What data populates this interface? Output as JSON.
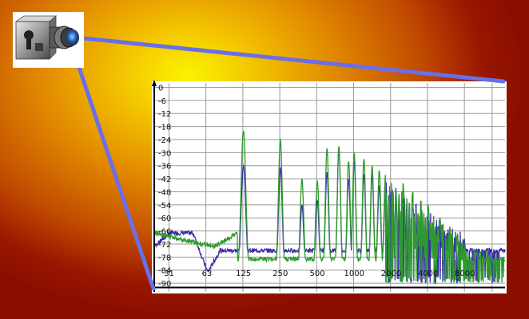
{
  "colors": {
    "beam": "#6a6ee8",
    "series_green": "#2e9a2e",
    "series_blue": "#3a2fa8",
    "axis": "#000000"
  },
  "camera": {
    "icon": "camera-icon"
  },
  "chart_data": {
    "type": "line",
    "y_ticks": [
      "0",
      "-6",
      "-12",
      "-18",
      "-24",
      "-30",
      "-36",
      "-42",
      "-48",
      "-54",
      "-60",
      "-66",
      "-72",
      "-78",
      "-84",
      "-90"
    ],
    "x_ticks": [
      "31",
      "63",
      "125",
      "250",
      "500",
      "1000",
      "2000",
      "4000",
      "8000"
    ],
    "ylim": [
      -94,
      2
    ],
    "xlim_log2": [
      4.55,
      14.05
    ],
    "grid": true,
    "series": [
      {
        "color": "green",
        "peaks": [
          {
            "x": 125,
            "y": -20
          },
          {
            "x": 250,
            "y": -24
          },
          {
            "x": 375,
            "y": -42
          },
          {
            "x": 500,
            "y": -43
          },
          {
            "x": 600,
            "y": -28
          },
          {
            "x": 750,
            "y": -27
          },
          {
            "x": 900,
            "y": -34
          },
          {
            "x": 1000,
            "y": -30
          },
          {
            "x": 1200,
            "y": -33
          },
          {
            "x": 1400,
            "y": -36
          },
          {
            "x": 1600,
            "y": -38
          },
          {
            "x": 1800,
            "y": -40
          },
          {
            "x": 2000,
            "y": -42
          },
          {
            "x": 2500,
            "y": -44
          },
          {
            "x": 3000,
            "y": -48
          },
          {
            "x": 3500,
            "y": -52
          },
          {
            "x": 4000,
            "y": -54
          },
          {
            "x": 5000,
            "y": -60
          },
          {
            "x": 6000,
            "y": -64
          },
          {
            "x": 7000,
            "y": -68
          },
          {
            "x": 8000,
            "y": -72
          },
          {
            "x": 10000,
            "y": -76
          }
        ]
      },
      {
        "color": "blue",
        "peaks": [
          {
            "x": 125,
            "y": -36
          },
          {
            "x": 250,
            "y": -37
          },
          {
            "x": 375,
            "y": -54
          },
          {
            "x": 500,
            "y": -52
          },
          {
            "x": 600,
            "y": -39
          },
          {
            "x": 750,
            "y": -28
          },
          {
            "x": 900,
            "y": -42
          },
          {
            "x": 1000,
            "y": -34
          },
          {
            "x": 1200,
            "y": -40
          },
          {
            "x": 1400,
            "y": -40
          },
          {
            "x": 1600,
            "y": -45
          },
          {
            "x": 1800,
            "y": -46
          },
          {
            "x": 2000,
            "y": -48
          },
          {
            "x": 2500,
            "y": -50
          },
          {
            "x": 3000,
            "y": -55
          },
          {
            "x": 3500,
            "y": -58
          },
          {
            "x": 4000,
            "y": -60
          },
          {
            "x": 5000,
            "y": -64
          },
          {
            "x": 6000,
            "y": -68
          },
          {
            "x": 8000,
            "y": -76
          }
        ]
      }
    ]
  }
}
